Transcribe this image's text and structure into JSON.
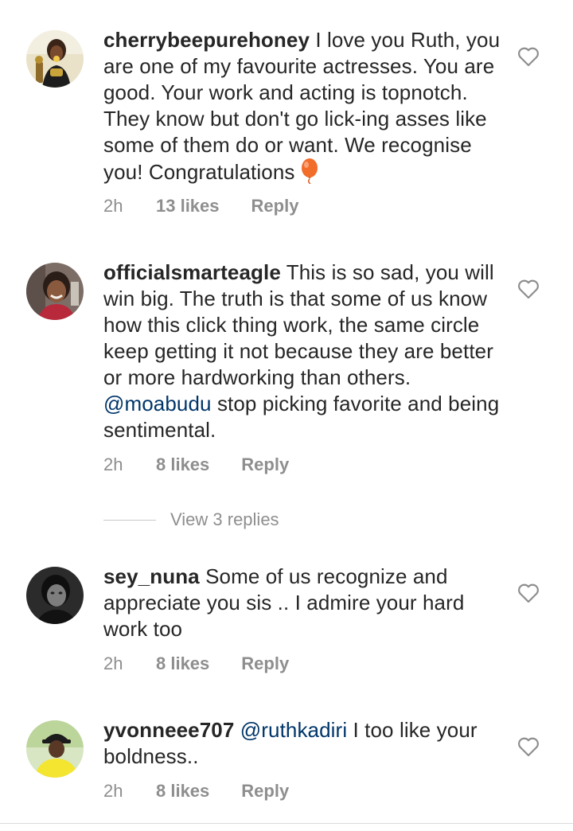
{
  "comments": [
    {
      "username": "cherrybeepurehoney",
      "text": " I love you Ruth, you are one of my favourite actresses. You are good. Your work and acting is topnotch. They know but don't go lick-ing asses like some of them do or want. We recognise you! Congratulations",
      "emoji": "balloon-emoji",
      "time": "2h",
      "likes": "13 likes",
      "reply": "Reply"
    },
    {
      "username": "officialsmarteagle",
      "text_before": " This is so sad, you will win big. The truth is that some of us know how this click thing work, the same circle keep getting it  not because they are better or more hardworking than others. ",
      "mention": "@moabudu",
      "text_after": " stop picking favorite and being sentimental.",
      "time": "2h",
      "likes": "8 likes",
      "reply": "Reply",
      "view_replies": "View 3 replies"
    },
    {
      "username": "sey_nuna",
      "text": " Some of us recognize and appreciate you sis .. I admire your hard work too",
      "time": "2h",
      "likes": "8 likes",
      "reply": "Reply"
    },
    {
      "username": "yvonneee707",
      "mention": "@ruthkadiri",
      "text_after": " I too like your boldness..",
      "time": "2h",
      "likes": "8 likes",
      "reply": "Reply"
    }
  ],
  "icons": {
    "like": "heart-outline-icon"
  },
  "colors": {
    "text": "#262626",
    "meta": "#8e8e8e",
    "mention": "#003569",
    "divider": "#c7c7c7"
  }
}
